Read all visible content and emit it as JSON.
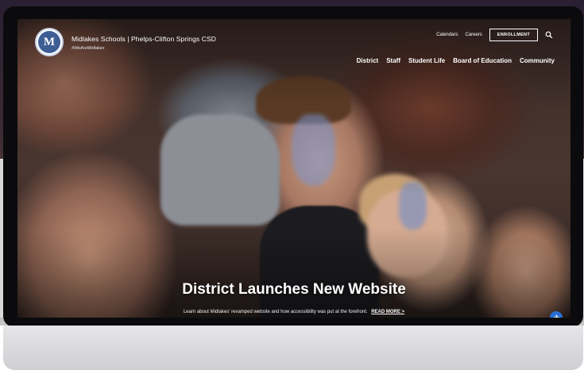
{
  "site": {
    "brand": "Midlakes Schools | Phelps-Clifton Springs CSD",
    "hashtag": "#WeAreMidlakes",
    "logo_letter": "M"
  },
  "utility_nav": {
    "calendars": "Calendars",
    "careers": "Careers",
    "enrollment": "ENROLLMENT"
  },
  "main_nav": [
    "District",
    "Staff",
    "Student Life",
    "Board of Education",
    "Community"
  ],
  "hero": {
    "headline": "District Launches New Website",
    "subline": "Learn about Midlakes' revamped website and how accessibility was put at the forefront.",
    "read_more": "READ MORE >"
  },
  "colors": {
    "accent_blue": "#3d5e95",
    "accessibility_button": "#2b6fd6"
  },
  "icons": [
    "search-icon",
    "accessibility-icon",
    "district-logo"
  ]
}
